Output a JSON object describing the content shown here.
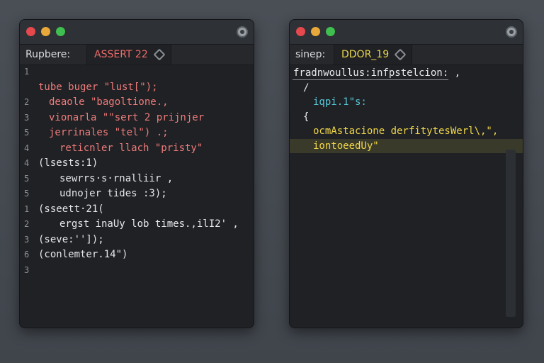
{
  "left_window": {
    "tab_label": "Rupbere:",
    "tab_active": "ASSERT  22",
    "lines": [
      {
        "num": "1",
        "text": "",
        "indent": 0,
        "color": "red"
      },
      {
        "num": "",
        "text": "tube buger \"lust[\");",
        "indent": 0,
        "color": "red"
      },
      {
        "num": "2",
        "text": "deaole \"bagoltione.,",
        "indent": 1,
        "color": "red"
      },
      {
        "num": "3",
        "text": "vionarla \"\"sert 2 prijnjer",
        "indent": 1,
        "color": "red"
      },
      {
        "num": "5",
        "text": "jerrinales \"tel\") .;",
        "indent": 1,
        "color": "red"
      },
      {
        "num": "4",
        "text": "reticnler llach \"pristy\"",
        "indent": 2,
        "color": "red"
      },
      {
        "num": "4",
        "text": "(lsests:1)",
        "indent": 0,
        "color": "white"
      },
      {
        "num": "5",
        "text": "sewrrs·s·rnalliir ,",
        "indent": 2,
        "color": "white"
      },
      {
        "num": "5",
        "text": "udnojer tides :3);",
        "indent": 2,
        "color": "white"
      },
      {
        "num": "1",
        "text": "(sseett·21(",
        "indent": 0,
        "color": "white"
      },
      {
        "num": "2",
        "text": "ergst inaUy lob times.,ilI2' ,",
        "indent": 2,
        "color": "white"
      },
      {
        "num": "3",
        "text": "(seve:'']);",
        "indent": 0,
        "color": "white"
      },
      {
        "num": "6",
        "text": "(conlemter.14\")",
        "indent": 0,
        "color": "white"
      },
      {
        "num": "3",
        "text": "",
        "indent": 0,
        "color": "white"
      }
    ]
  },
  "right_window": {
    "tab_label": "sinep:",
    "tab_active": "DDOR_19",
    "lines": [
      {
        "num": "",
        "text": "fradnwoullus:infpstelcion: ,",
        "indent": 0,
        "color": "white"
      },
      {
        "num": "",
        "text": "/",
        "indent": 1,
        "color": "white"
      },
      {
        "num": "",
        "text": "iqpi.1\"s:",
        "indent": 2,
        "color": "cyan"
      },
      {
        "num": "",
        "text": "{",
        "indent": 1,
        "color": "white"
      },
      {
        "num": "",
        "text": "ocmAstacione derfitytesWerl\\,\",",
        "indent": 2,
        "color": "yellow"
      },
      {
        "num": "",
        "text": "iontoeedUy\"",
        "indent": 2,
        "color": "yellow"
      }
    ]
  }
}
